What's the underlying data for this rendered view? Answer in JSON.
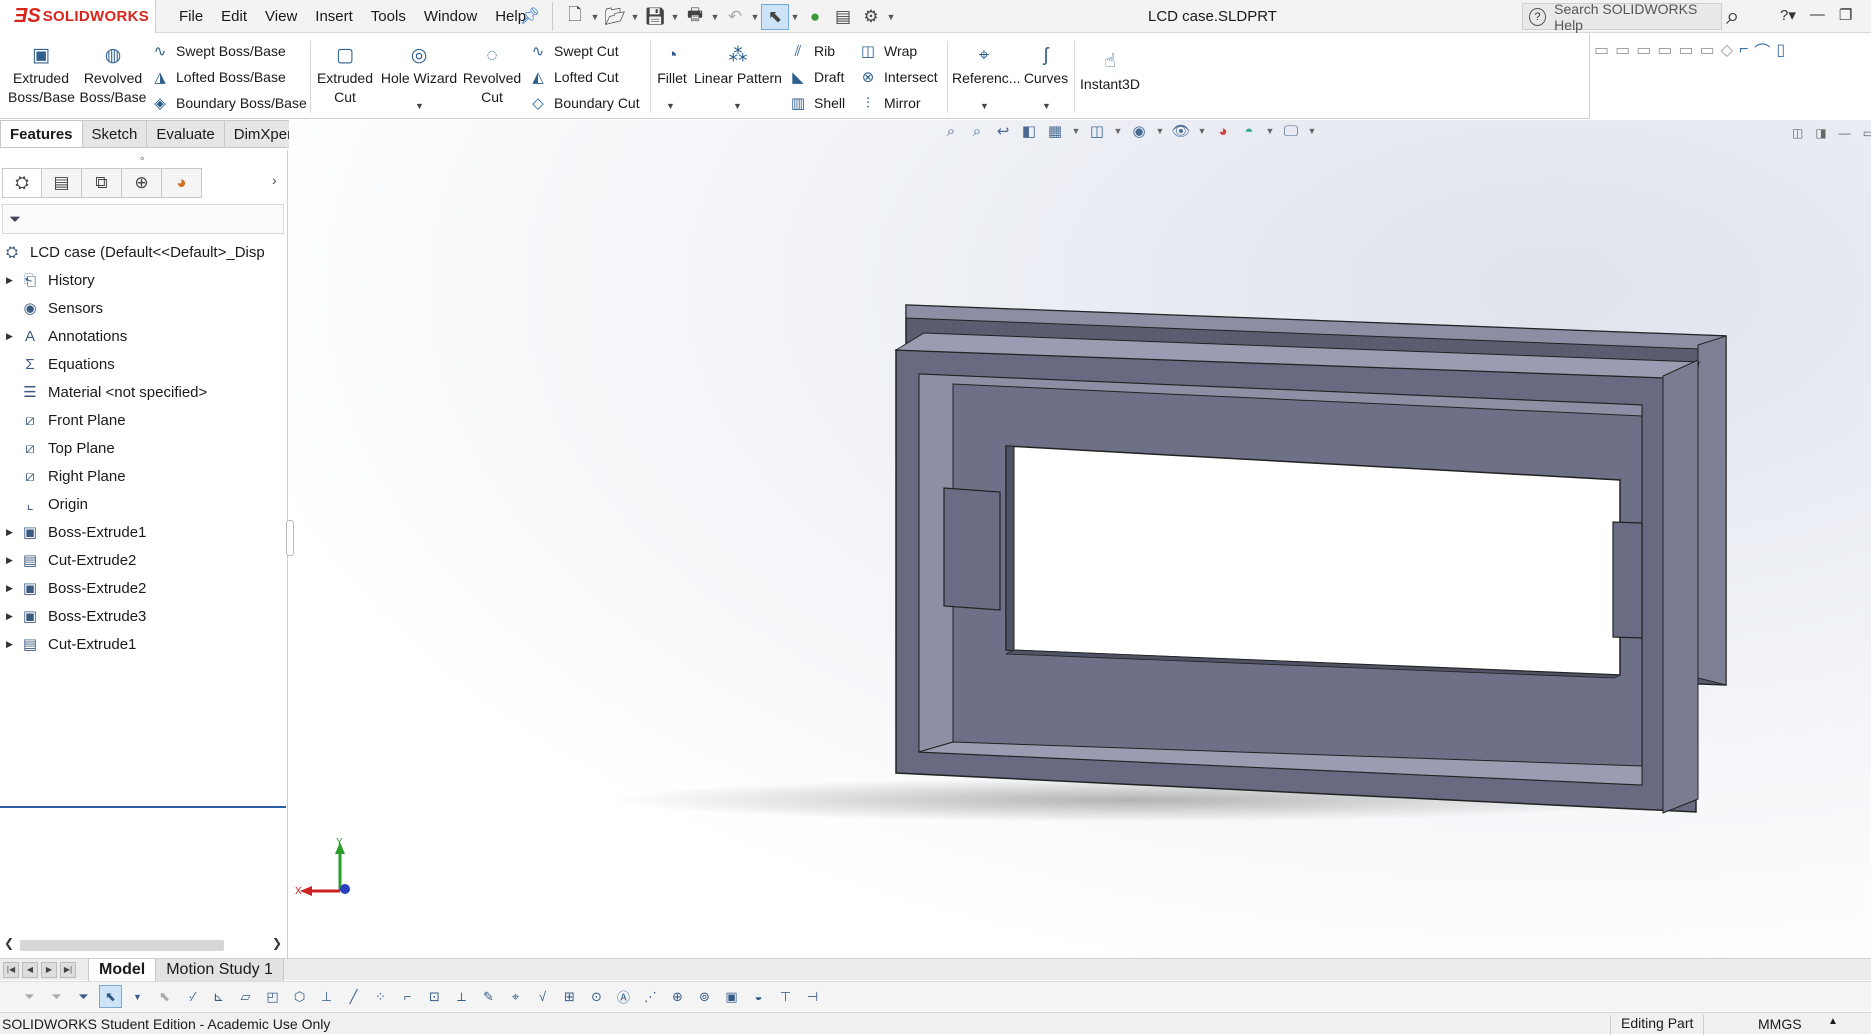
{
  "app": {
    "brand": "SOLIDWORKS",
    "document_title": "LCD case.SLDPRT",
    "menu": [
      "File",
      "Edit",
      "View",
      "Insert",
      "Tools",
      "Window",
      "Help"
    ],
    "help_search_placeholder": "Search SOLIDWORKS Help"
  },
  "command_manager": {
    "extruded_boss": "Extruded Boss/Base",
    "revolved_boss": "Revolved Boss/Base",
    "swept_boss": "Swept Boss/Base",
    "lofted_boss": "Lofted Boss/Base",
    "boundary_boss": "Boundary Boss/Base",
    "extruded_cut": "Extruded Cut",
    "hole_wizard": "Hole Wizard",
    "revolved_cut": "Revolved Cut",
    "swept_cut": "Swept Cut",
    "lofted_cut": "Lofted Cut",
    "boundary_cut": "Boundary Cut",
    "fillet": "Fillet",
    "linear_pattern": "Linear Pattern",
    "rib": "Rib",
    "draft": "Draft",
    "shell": "Shell",
    "wrap": "Wrap",
    "intersect": "Intersect",
    "mirror": "Mirror",
    "reference": "Referenc...",
    "curves": "Curves",
    "instant3d": "Instant3D",
    "tabs": [
      "Features",
      "Sketch",
      "Evaluate",
      "DimXpert"
    ],
    "active_tab": "Features"
  },
  "feature_tree": {
    "root": "LCD case  (Default<<Default>_Disp",
    "items": [
      {
        "label": "History",
        "icon": "history-folder-icon",
        "expandable": true
      },
      {
        "label": "Sensors",
        "icon": "sensors-icon",
        "expandable": false
      },
      {
        "label": "Annotations",
        "icon": "annotations-icon",
        "expandable": true
      },
      {
        "label": "Equations",
        "icon": "equations-icon",
        "expandable": false
      },
      {
        "label": "Material <not specified>",
        "icon": "material-icon",
        "expandable": false
      },
      {
        "label": "Front Plane",
        "icon": "plane-icon",
        "expandable": false
      },
      {
        "label": "Top Plane",
        "icon": "plane-icon",
        "expandable": false
      },
      {
        "label": "Right Plane",
        "icon": "plane-icon",
        "expandable": false
      },
      {
        "label": "Origin",
        "icon": "origin-icon",
        "expandable": false
      },
      {
        "label": "Boss-Extrude1",
        "icon": "boss-extrude-icon",
        "expandable": true
      },
      {
        "label": "Cut-Extrude2",
        "icon": "cut-extrude-icon",
        "expandable": true
      },
      {
        "label": "Boss-Extrude2",
        "icon": "boss-extrude-icon",
        "expandable": true
      },
      {
        "label": "Boss-Extrude3",
        "icon": "boss-extrude-icon",
        "expandable": true
      },
      {
        "label": "Cut-Extrude1",
        "icon": "cut-extrude-icon",
        "expandable": true
      }
    ]
  },
  "triad": {
    "x": "X",
    "y": "Y"
  },
  "bottom_tabs": [
    "Model",
    "Motion Study 1"
  ],
  "status": {
    "left": "SOLIDWORKS Student Edition - Academic Use Only",
    "mode": "Editing Part",
    "units": "MMGS"
  },
  "colors": {
    "brand_red": "#d9261c",
    "part_face": "#6b6e84",
    "part_top": "#9598ad",
    "part_dark": "#4f5264",
    "selection_blue": "#2b5ca8"
  }
}
